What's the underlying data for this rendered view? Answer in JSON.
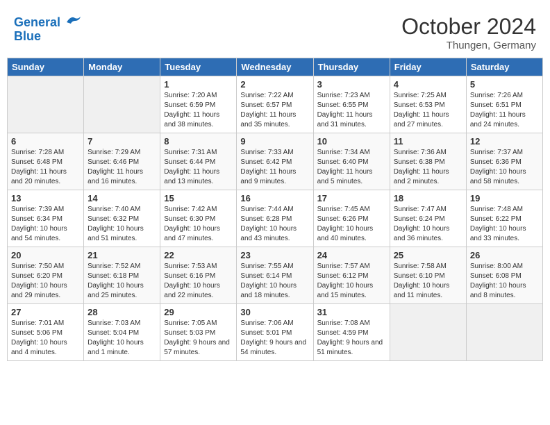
{
  "header": {
    "logo_line1": "General",
    "logo_line2": "Blue",
    "month_title": "October 2024",
    "location": "Thungen, Germany"
  },
  "weekdays": [
    "Sunday",
    "Monday",
    "Tuesday",
    "Wednesday",
    "Thursday",
    "Friday",
    "Saturday"
  ],
  "weeks": [
    [
      {
        "day": "",
        "info": ""
      },
      {
        "day": "",
        "info": ""
      },
      {
        "day": "1",
        "info": "Sunrise: 7:20 AM\nSunset: 6:59 PM\nDaylight: 11 hours and 38 minutes."
      },
      {
        "day": "2",
        "info": "Sunrise: 7:22 AM\nSunset: 6:57 PM\nDaylight: 11 hours and 35 minutes."
      },
      {
        "day": "3",
        "info": "Sunrise: 7:23 AM\nSunset: 6:55 PM\nDaylight: 11 hours and 31 minutes."
      },
      {
        "day": "4",
        "info": "Sunrise: 7:25 AM\nSunset: 6:53 PM\nDaylight: 11 hours and 27 minutes."
      },
      {
        "day": "5",
        "info": "Sunrise: 7:26 AM\nSunset: 6:51 PM\nDaylight: 11 hours and 24 minutes."
      }
    ],
    [
      {
        "day": "6",
        "info": "Sunrise: 7:28 AM\nSunset: 6:48 PM\nDaylight: 11 hours and 20 minutes."
      },
      {
        "day": "7",
        "info": "Sunrise: 7:29 AM\nSunset: 6:46 PM\nDaylight: 11 hours and 16 minutes."
      },
      {
        "day": "8",
        "info": "Sunrise: 7:31 AM\nSunset: 6:44 PM\nDaylight: 11 hours and 13 minutes."
      },
      {
        "day": "9",
        "info": "Sunrise: 7:33 AM\nSunset: 6:42 PM\nDaylight: 11 hours and 9 minutes."
      },
      {
        "day": "10",
        "info": "Sunrise: 7:34 AM\nSunset: 6:40 PM\nDaylight: 11 hours and 5 minutes."
      },
      {
        "day": "11",
        "info": "Sunrise: 7:36 AM\nSunset: 6:38 PM\nDaylight: 11 hours and 2 minutes."
      },
      {
        "day": "12",
        "info": "Sunrise: 7:37 AM\nSunset: 6:36 PM\nDaylight: 10 hours and 58 minutes."
      }
    ],
    [
      {
        "day": "13",
        "info": "Sunrise: 7:39 AM\nSunset: 6:34 PM\nDaylight: 10 hours and 54 minutes."
      },
      {
        "day": "14",
        "info": "Sunrise: 7:40 AM\nSunset: 6:32 PM\nDaylight: 10 hours and 51 minutes."
      },
      {
        "day": "15",
        "info": "Sunrise: 7:42 AM\nSunset: 6:30 PM\nDaylight: 10 hours and 47 minutes."
      },
      {
        "day": "16",
        "info": "Sunrise: 7:44 AM\nSunset: 6:28 PM\nDaylight: 10 hours and 43 minutes."
      },
      {
        "day": "17",
        "info": "Sunrise: 7:45 AM\nSunset: 6:26 PM\nDaylight: 10 hours and 40 minutes."
      },
      {
        "day": "18",
        "info": "Sunrise: 7:47 AM\nSunset: 6:24 PM\nDaylight: 10 hours and 36 minutes."
      },
      {
        "day": "19",
        "info": "Sunrise: 7:48 AM\nSunset: 6:22 PM\nDaylight: 10 hours and 33 minutes."
      }
    ],
    [
      {
        "day": "20",
        "info": "Sunrise: 7:50 AM\nSunset: 6:20 PM\nDaylight: 10 hours and 29 minutes."
      },
      {
        "day": "21",
        "info": "Sunrise: 7:52 AM\nSunset: 6:18 PM\nDaylight: 10 hours and 25 minutes."
      },
      {
        "day": "22",
        "info": "Sunrise: 7:53 AM\nSunset: 6:16 PM\nDaylight: 10 hours and 22 minutes."
      },
      {
        "day": "23",
        "info": "Sunrise: 7:55 AM\nSunset: 6:14 PM\nDaylight: 10 hours and 18 minutes."
      },
      {
        "day": "24",
        "info": "Sunrise: 7:57 AM\nSunset: 6:12 PM\nDaylight: 10 hours and 15 minutes."
      },
      {
        "day": "25",
        "info": "Sunrise: 7:58 AM\nSunset: 6:10 PM\nDaylight: 10 hours and 11 minutes."
      },
      {
        "day": "26",
        "info": "Sunrise: 8:00 AM\nSunset: 6:08 PM\nDaylight: 10 hours and 8 minutes."
      }
    ],
    [
      {
        "day": "27",
        "info": "Sunrise: 7:01 AM\nSunset: 5:06 PM\nDaylight: 10 hours and 4 minutes."
      },
      {
        "day": "28",
        "info": "Sunrise: 7:03 AM\nSunset: 5:04 PM\nDaylight: 10 hours and 1 minute."
      },
      {
        "day": "29",
        "info": "Sunrise: 7:05 AM\nSunset: 5:03 PM\nDaylight: 9 hours and 57 minutes."
      },
      {
        "day": "30",
        "info": "Sunrise: 7:06 AM\nSunset: 5:01 PM\nDaylight: 9 hours and 54 minutes."
      },
      {
        "day": "31",
        "info": "Sunrise: 7:08 AM\nSunset: 4:59 PM\nDaylight: 9 hours and 51 minutes."
      },
      {
        "day": "",
        "info": ""
      },
      {
        "day": "",
        "info": ""
      }
    ]
  ]
}
